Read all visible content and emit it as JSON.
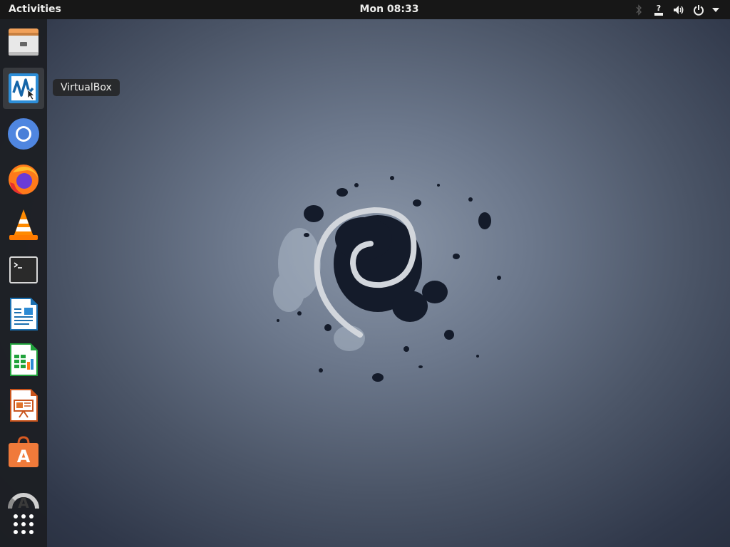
{
  "topbar": {
    "activities_label": "Activities",
    "clock": "Mon 08:33",
    "status_icons": [
      "bluetooth-icon",
      "accessibility-icon",
      "volume-icon",
      "power-icon",
      "menu-arrow-icon"
    ]
  },
  "dock": {
    "items": [
      {
        "name": "files",
        "icon": "file-cabinet-icon"
      },
      {
        "name": "virtualbox",
        "icon": "virtualbox-icon",
        "hovered": true
      },
      {
        "name": "chromium",
        "icon": "chromium-icon"
      },
      {
        "name": "firefox",
        "icon": "firefox-icon"
      },
      {
        "name": "vlc",
        "icon": "vlc-cone-icon"
      },
      {
        "name": "terminal",
        "icon": "terminal-icon"
      },
      {
        "name": "libreoffice-writer",
        "icon": "writer-document-icon"
      },
      {
        "name": "libreoffice-calc",
        "icon": "calc-spreadsheet-icon"
      },
      {
        "name": "libreoffice-impress",
        "icon": "impress-presentation-icon"
      },
      {
        "name": "software",
        "icon": "software-bag-icon"
      },
      {
        "name": "updater",
        "icon": "software-update-icon"
      },
      {
        "name": "show-applications",
        "icon": "app-grid-icon"
      }
    ],
    "tooltip": "VirtualBox"
  },
  "colors": {
    "topbar_bg": "#171717",
    "dock_bg": "#1c1e22",
    "wallpaper_center": "#8a96a8",
    "wallpaper_edge": "#272e3e",
    "swirl": "#d2d6dc",
    "splatter": "#141b2a"
  }
}
